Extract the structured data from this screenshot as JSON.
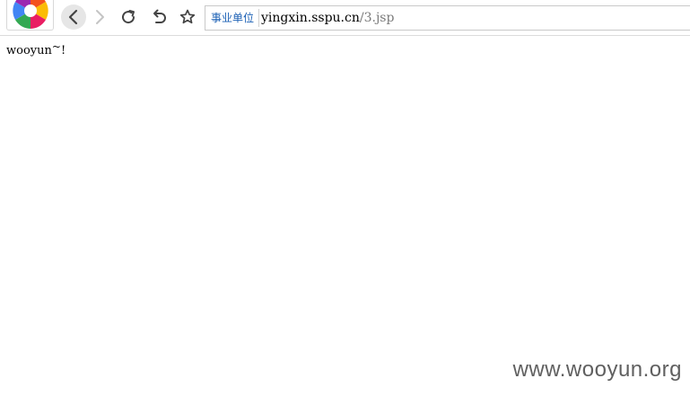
{
  "address_bar": {
    "cert_badge": "事业单位",
    "url_host": "yingxin.sspu.cn",
    "url_path": "/3.jsp"
  },
  "page": {
    "text_main": "wooyun",
    "text_tilde": "~",
    "text_end": "!"
  },
  "watermark": "www.wooyun.org",
  "icons": {
    "logo": "browser-logo-icon",
    "back": "chevron-left-icon",
    "forward": "chevron-right-icon",
    "reload": "reload-icon",
    "undo": "undo-icon",
    "favorite": "star-icon"
  }
}
